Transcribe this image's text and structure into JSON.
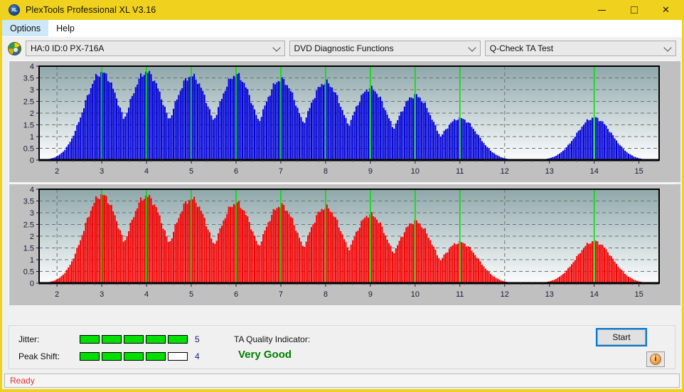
{
  "window": {
    "title": "PlexTools Professional XL V3.16",
    "logo_text": "XL",
    "minimize_label": "Minimize",
    "maximize_label": "Maximize",
    "close_label": "Close",
    "close_glyph": "✕",
    "titlebar_color": "#f0d11e"
  },
  "menu": {
    "items": [
      {
        "label": "Options"
      },
      {
        "label": "Help"
      }
    ]
  },
  "selectors": {
    "drive": {
      "value": "HA:0 ID:0  PX-716A"
    },
    "function": {
      "value": "DVD Diagnostic Functions"
    },
    "test": {
      "value": "Q-Check TA Test"
    }
  },
  "indicators": {
    "jitter": {
      "label": "Jitter:",
      "value": 5,
      "total": 5,
      "value_text": "5"
    },
    "peak_shift": {
      "label": "Peak Shift:",
      "value": 4,
      "total": 5,
      "value_text": "4"
    },
    "quality": {
      "label": "TA Quality Indicator:",
      "value": "Very Good",
      "color": "#008000"
    }
  },
  "buttons": {
    "start": "Start",
    "info": "i"
  },
  "status": {
    "text": "Ready",
    "color": "#e03030"
  },
  "chart_data": [
    {
      "type": "bar",
      "id": "jitter-chart",
      "title": "",
      "xlabel": "",
      "ylabel": "",
      "color": "#0000d8",
      "marker_color": "#00e000",
      "ylim": [
        0,
        4
      ],
      "yticks": [
        0,
        0.5,
        1,
        1.5,
        2,
        2.5,
        3,
        3.5,
        4
      ],
      "ytick_labels": [
        "0",
        "0.5",
        "1",
        "1.5",
        "2",
        "2.5",
        "3",
        "3.5",
        "4"
      ],
      "xlim": [
        1.6,
        15.45
      ],
      "xticks": [
        2,
        3,
        4,
        5,
        6,
        7,
        8,
        9,
        10,
        11,
        12,
        13,
        14,
        15
      ],
      "xtick_labels": [
        "2",
        "3",
        "4",
        "5",
        "6",
        "7",
        "8",
        "9",
        "10",
        "11",
        "12",
        "13",
        "14",
        "15"
      ],
      "grid": true,
      "markers": [
        3,
        4,
        5,
        6,
        7,
        8,
        9,
        10,
        11,
        14
      ],
      "peaks": [
        {
          "center": 3.0,
          "height": 3.72
        },
        {
          "center": 4.0,
          "height": 3.74
        },
        {
          "center": 5.0,
          "height": 3.58
        },
        {
          "center": 6.0,
          "height": 3.62
        },
        {
          "center": 7.0,
          "height": 3.42
        },
        {
          "center": 8.0,
          "height": 3.3
        },
        {
          "center": 9.0,
          "height": 3.05
        },
        {
          "center": 10.0,
          "height": 2.75
        },
        {
          "center": 11.0,
          "height": 1.78
        },
        {
          "center": 14.0,
          "height": 1.8
        }
      ]
    },
    {
      "type": "bar",
      "id": "peak-shift-chart",
      "title": "",
      "xlabel": "",
      "ylabel": "",
      "color": "#f40000",
      "marker_color": "#00e000",
      "ylim": [
        0,
        4
      ],
      "yticks": [
        0,
        0.5,
        1,
        1.5,
        2,
        2.5,
        3,
        3.5,
        4
      ],
      "ytick_labels": [
        "0",
        "0.5",
        "1",
        "1.5",
        "2",
        "2.5",
        "3",
        "3.5",
        "4"
      ],
      "xlim": [
        1.6,
        15.45
      ],
      "xticks": [
        2,
        3,
        4,
        5,
        6,
        7,
        8,
        9,
        10,
        11,
        12,
        13,
        14,
        15
      ],
      "xtick_labels": [
        "2",
        "3",
        "4",
        "5",
        "6",
        "7",
        "8",
        "9",
        "10",
        "11",
        "12",
        "13",
        "14",
        "15"
      ],
      "grid": true,
      "markers": [
        3,
        4,
        5,
        6,
        7,
        8,
        9,
        10,
        11,
        14
      ],
      "peaks": [
        {
          "center": 3.0,
          "height": 3.75
        },
        {
          "center": 4.0,
          "height": 3.7
        },
        {
          "center": 5.0,
          "height": 3.58
        },
        {
          "center": 6.0,
          "height": 3.4
        },
        {
          "center": 7.0,
          "height": 3.3
        },
        {
          "center": 8.0,
          "height": 3.22
        },
        {
          "center": 9.0,
          "height": 2.92
        },
        {
          "center": 10.0,
          "height": 2.62
        },
        {
          "center": 11.0,
          "height": 1.74
        },
        {
          "center": 14.0,
          "height": 1.78
        }
      ]
    }
  ]
}
